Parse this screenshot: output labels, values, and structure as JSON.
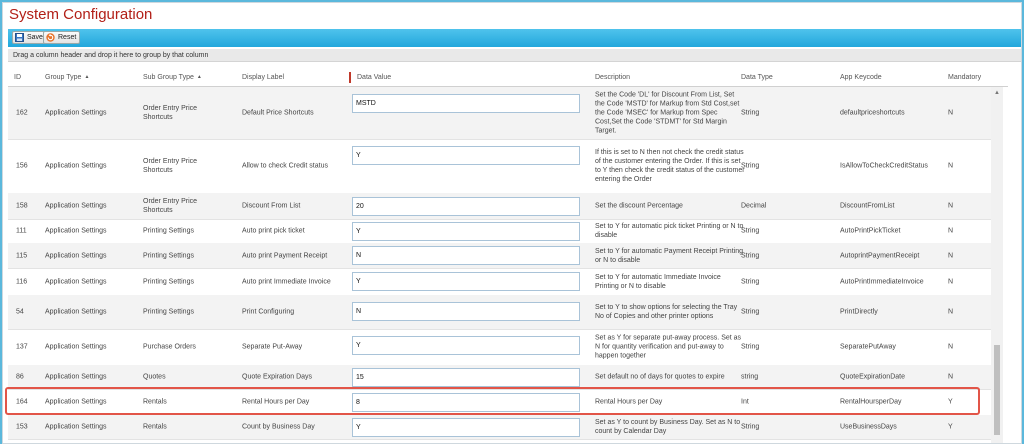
{
  "page": {
    "title": "System Configuration"
  },
  "toolbar": {
    "save_label": "Save",
    "reset_label": "Reset"
  },
  "grid": {
    "group_hint": "Drag a column header and drop it here to group by that column",
    "columns": {
      "id": "ID",
      "group_type": "Group Type",
      "sub_group_type": "Sub Group Type",
      "display_label": "Display Label",
      "data_value": "Data Value",
      "description": "Description",
      "data_type": "Data Type",
      "app_keycode": "App Keycode",
      "mandatory": "Mandatory"
    },
    "rows": [
      {
        "id": "162",
        "group": "Application Settings",
        "sub": "Order Entry Price Shortcuts",
        "label": "Default Price Shortcuts",
        "value": "MSTD",
        "desc": "Set the Code 'DL' for Discount From List, Set the Code 'MSTD' for Markup from Std Cost,set the Code 'MSEC' for Markup from Spec Cost,Set the Code 'STDMT' for Std Margin Target.",
        "type": "String",
        "key": "defaultpriceshortcuts",
        "mand": "N"
      },
      {
        "id": "156",
        "group": "Application Settings",
        "sub": "Order Entry Price Shortcuts",
        "label": "Allow to check Credit status",
        "value": "Y",
        "desc": "If this is set to N then not check the credit status of the customer entering the Order. If this is set to Y then check the credit status of the customer entering the Order",
        "type": "String",
        "key": "IsAllowToCheckCreditStatus",
        "mand": "N"
      },
      {
        "id": "158",
        "group": "Application Settings",
        "sub": "Order Entry Price Shortcuts",
        "label": "Discount From List",
        "value": "20",
        "desc": "Set the discount Percentage",
        "type": "Decimal",
        "key": "DiscountFromList",
        "mand": "N"
      },
      {
        "id": "111",
        "group": "Application Settings",
        "sub": "Printing Settings",
        "label": "Auto print pick ticket",
        "value": "Y",
        "desc": "Set to Y for automatic pick ticket Printing or N to disable",
        "type": "String",
        "key": "AutoPrintPickTicket",
        "mand": "N"
      },
      {
        "id": "115",
        "group": "Application Settings",
        "sub": "Printing Settings",
        "label": "Auto print Payment Receipt",
        "value": "N",
        "desc": "Set to Y for automatic Payment Receipt Printing or N to disable",
        "type": "String",
        "key": "AutoprintPaymentReceipt",
        "mand": "N"
      },
      {
        "id": "116",
        "group": "Application Settings",
        "sub": "Printing Settings",
        "label": "Auto print Immediate Invoice",
        "value": "Y",
        "desc": "Set to Y for automatic Immediate Invoice Printing or N to disable",
        "type": "String",
        "key": "AutoPrintImmediateInvoice",
        "mand": "N"
      },
      {
        "id": "54",
        "group": "Application Settings",
        "sub": "Printing Settings",
        "label": "Print Configuring",
        "value": "N",
        "desc": "Set to Y to show options for selecting the Tray No of Copies and other printer options",
        "type": "String",
        "key": "PrintDirectly",
        "mand": "N"
      },
      {
        "id": "137",
        "group": "Application Settings",
        "sub": "Purchase Orders",
        "label": "Separate Put-Away",
        "value": "Y",
        "desc": "Set as Y for separate put-away process. Set as N for quantity verification and put-away to happen together",
        "type": "String",
        "key": "SeparatePutAway",
        "mand": "N"
      },
      {
        "id": "86",
        "group": "Application Settings",
        "sub": "Quotes",
        "label": "Quote Expiration Days",
        "value": "15",
        "desc": "Set default no of days for quotes to expire",
        "type": "string",
        "key": "QuoteExpirationDate",
        "mand": "N"
      },
      {
        "id": "164",
        "group": "Application Settings",
        "sub": "Rentals",
        "label": "Rental Hours per Day",
        "value": "8",
        "desc": "Rental Hours per Day",
        "type": "Int",
        "key": "RentalHoursperDay",
        "mand": "Y"
      },
      {
        "id": "153",
        "group": "Application Settings",
        "sub": "Rentals",
        "label": "Count by Business Day",
        "value": "Y",
        "desc": "Set as Y to count by Business Day. Set as N to count by Calendar Day",
        "type": "String",
        "key": "UseBusinessDays",
        "mand": "Y"
      }
    ]
  }
}
